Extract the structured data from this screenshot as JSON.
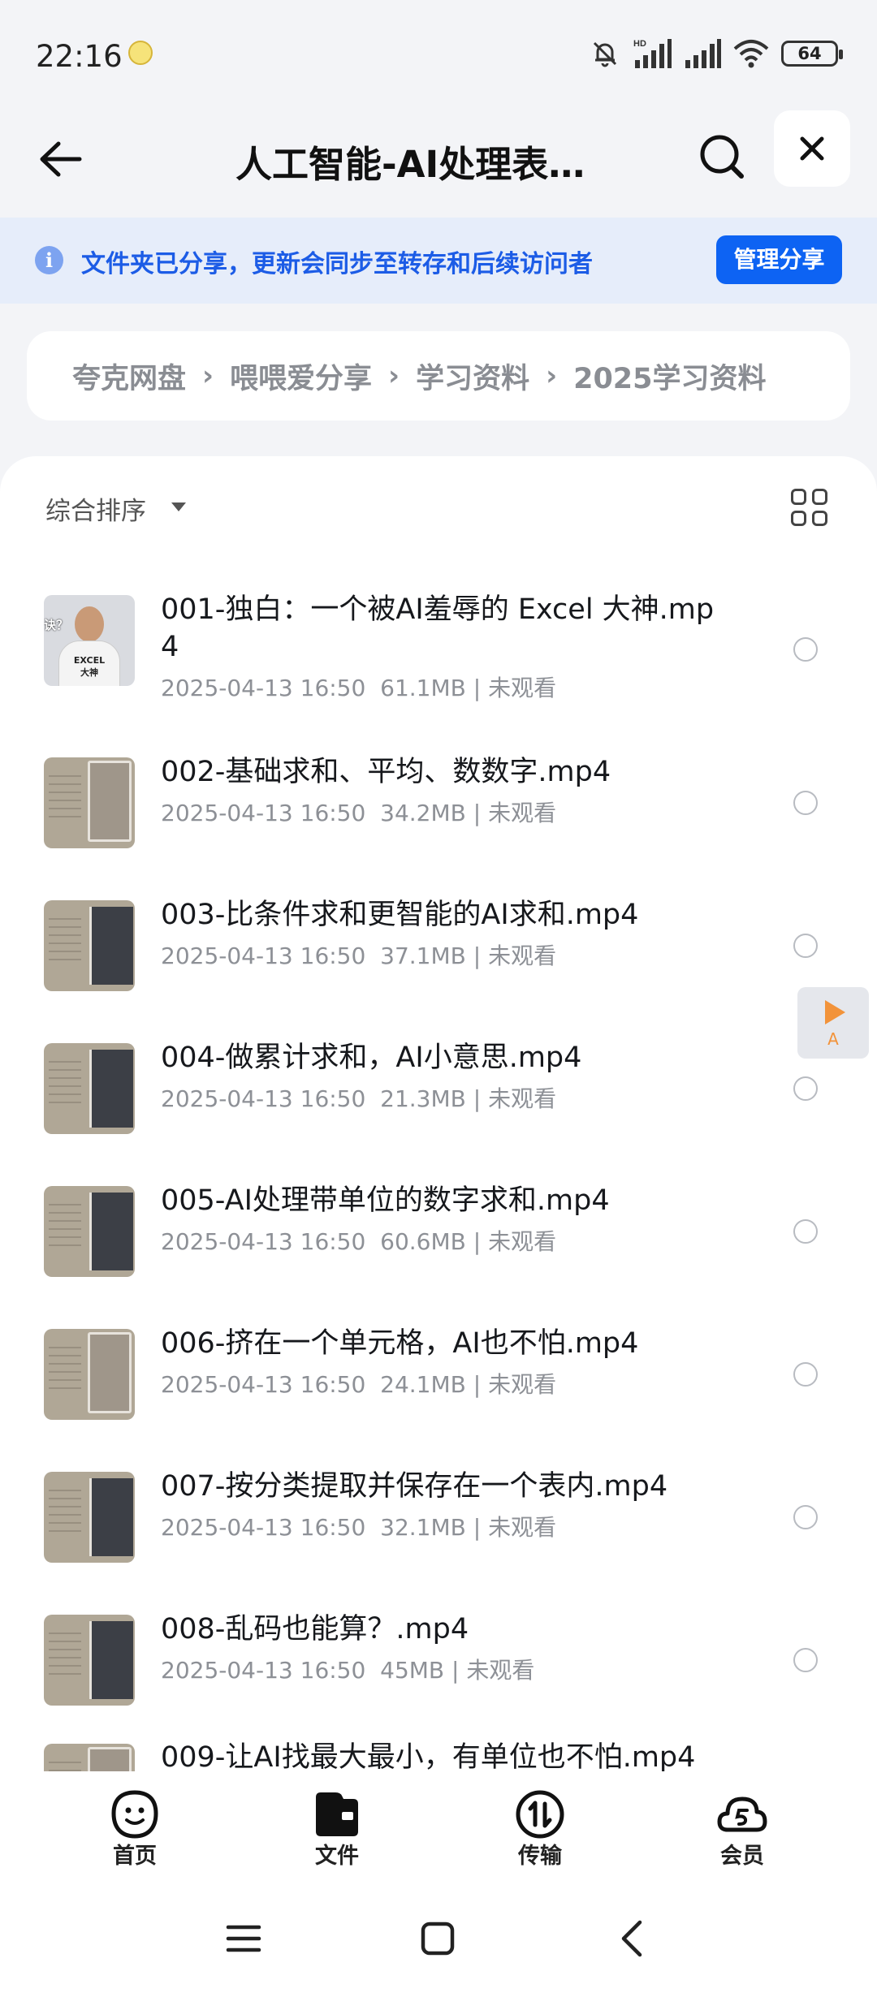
{
  "status_bar": {
    "time": "22:16",
    "battery": "64",
    "network_label": "HD"
  },
  "header": {
    "title": "人工智能-AI处理表格...",
    "icons": [
      "back-arrow-icon",
      "search-icon",
      "close-icon"
    ]
  },
  "share_banner": {
    "text": "文件夹已分享，更新会同步至转存和后续访问者",
    "button": "管理分享",
    "accent_color": "#0d63f3"
  },
  "breadcrumb": [
    "夸克网盘",
    "喂喂爱分享",
    "学习资料",
    "2025学习资料"
  ],
  "toolbar": {
    "sort_label": "综合排序"
  },
  "files": [
    {
      "name": "001-独白：一个被AI羞辱的 Excel 大神.mp4",
      "date": "2025-04-13 16:50",
      "size": "61.1MB",
      "status": "未观看",
      "thumb": "person"
    },
    {
      "name": "002-基础求和、平均、数数字.mp4",
      "date": "2025-04-13 16:50",
      "size": "34.2MB",
      "status": "未观看",
      "thumb": "doc"
    },
    {
      "name": "003-比条件求和更智能的AI求和.mp4",
      "date": "2025-04-13 16:50",
      "size": "37.1MB",
      "status": "未观看",
      "thumb": "dark"
    },
    {
      "name": "004-做累计求和，AI小意思.mp4",
      "date": "2025-04-13 16:50",
      "size": "21.3MB",
      "status": "未观看",
      "thumb": "dark"
    },
    {
      "name": "005-AI处理带单位的数字求和.mp4",
      "date": "2025-04-13 16:50",
      "size": "60.6MB",
      "status": "未观看",
      "thumb": "dark"
    },
    {
      "name": "006-挤在一个单元格，AI也不怕.mp4",
      "date": "2025-04-13 16:50",
      "size": "24.1MB",
      "status": "未观看",
      "thumb": "doc"
    },
    {
      "name": "007-按分类提取并保存在一个表内.mp4",
      "date": "2025-04-13 16:50",
      "size": "32.1MB",
      "status": "未观看",
      "thumb": "dark"
    },
    {
      "name": "008-乱码也能算？.mp4",
      "date": "2025-04-13 16:50",
      "size": "45MB",
      "status": "未观看",
      "thumb": "dark"
    },
    {
      "name": "009-让AI找最大最小，有单位也不怕.mp4",
      "date": "",
      "size": "",
      "status": "",
      "thumb": "doc"
    }
  ],
  "thumb_text": {
    "corner": "诀？",
    "shirt": "EXCEL\n大神"
  },
  "float_button": {
    "label": "A"
  },
  "bottom_nav": [
    {
      "label": "首页",
      "icon": "smiley-home-icon"
    },
    {
      "label": "文件",
      "icon": "folder-icon"
    },
    {
      "label": "传输",
      "icon": "transfer-icon"
    },
    {
      "label": "会员",
      "icon": "vip-cloud-icon"
    }
  ]
}
